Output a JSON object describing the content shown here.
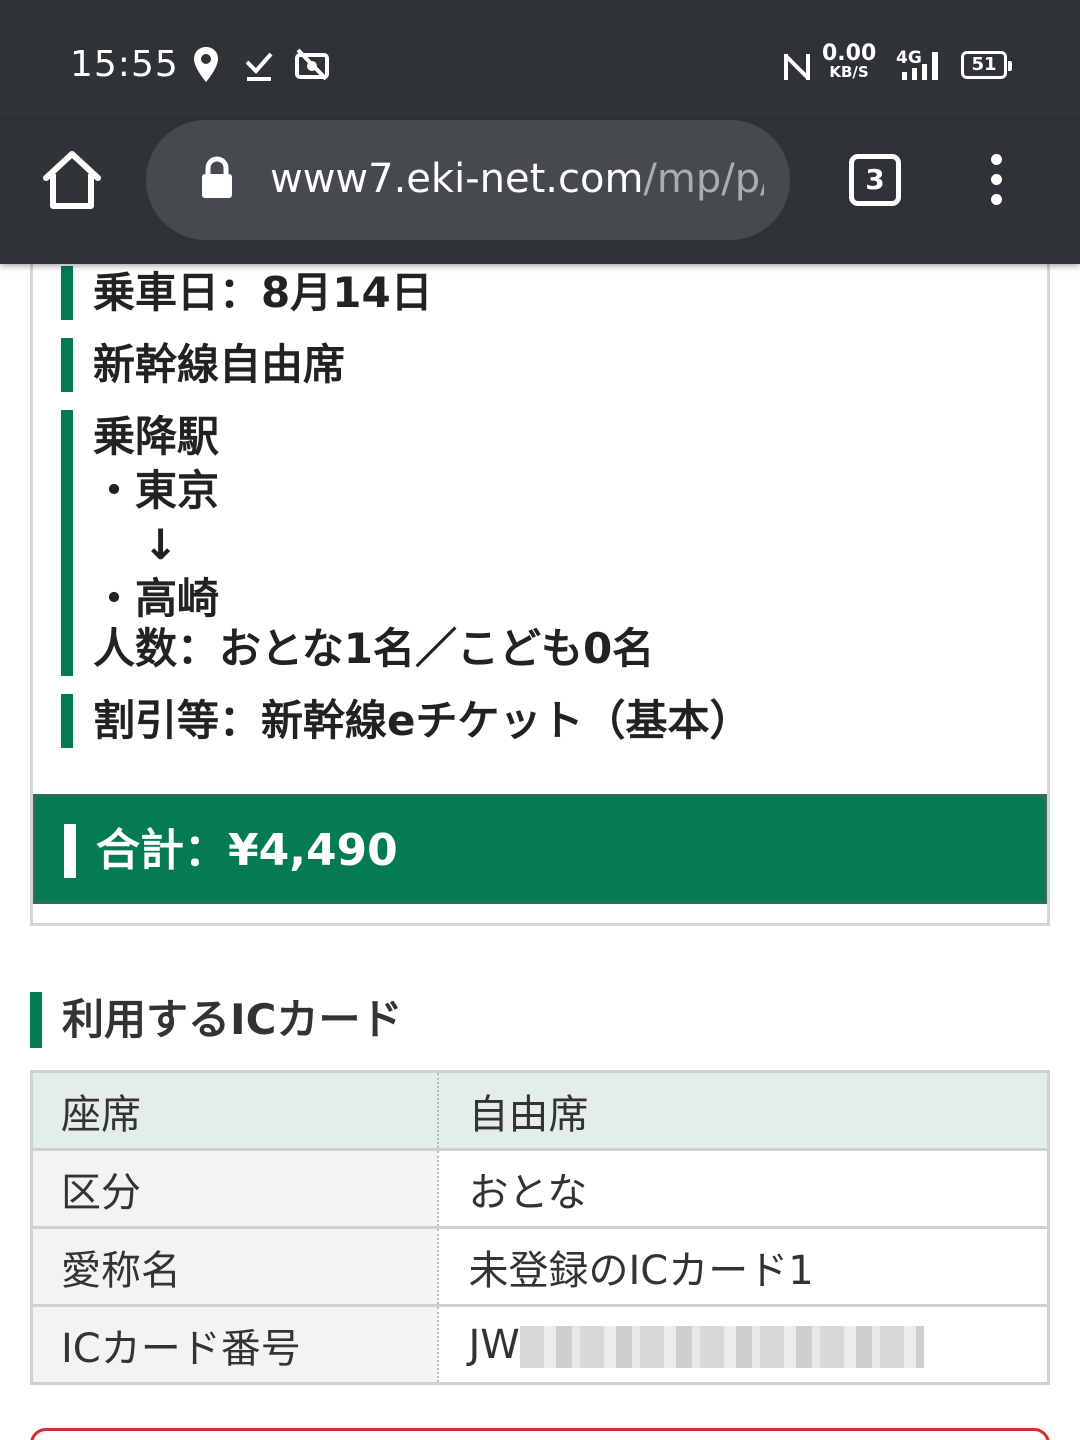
{
  "status_bar": {
    "time": "15:55",
    "network_speed": "0.00",
    "network_speed_unit": "KB/S",
    "network_type": "4G",
    "battery": "51",
    "icons": [
      "location-icon",
      "download-done-icon",
      "no-photo-icon",
      "nfc-icon",
      "signal-icon",
      "battery-icon"
    ]
  },
  "browser": {
    "url_host": "www7.eki-net.com",
    "url_path": "/mp/p/",
    "tab_count": "3"
  },
  "ticket": {
    "date": "乗車日：8月14日",
    "seat_type": "新幹線自由席",
    "stations_label": "乗降駅",
    "from_station": "・東京",
    "arrow": "↓",
    "to_station": "・高崎",
    "passengers": "人数：おとな1名／こども0名",
    "discount": "割引等：新幹線eチケット（基本）",
    "total": "合計：¥4,490"
  },
  "ic_section": {
    "title": "利用するICカード",
    "rows": [
      {
        "key": "座席",
        "value": "自由席"
      },
      {
        "key": "区分",
        "value": "おとな"
      },
      {
        "key": "愛称名",
        "value": "未登録のICカード1"
      },
      {
        "key": "ICカード番号",
        "value": "JW"
      }
    ]
  },
  "colors": {
    "accent": "#047a55",
    "status_bar": "#303336",
    "url_box": "#46494d",
    "warning_border": "#d32f2f"
  }
}
